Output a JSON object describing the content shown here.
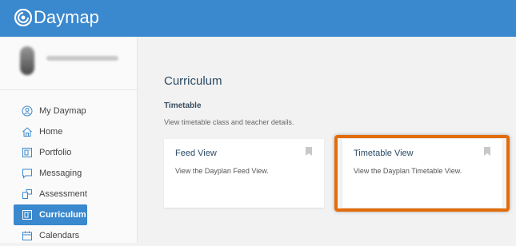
{
  "app": {
    "logo_text": "Daymap"
  },
  "profile": {
    "username": ""
  },
  "sidebar": {
    "items": [
      {
        "label": "My Daymap",
        "icon": "user-circle-icon"
      },
      {
        "label": "Home",
        "icon": "home-icon"
      },
      {
        "label": "Portfolio",
        "icon": "portfolio-icon"
      },
      {
        "label": "Messaging",
        "icon": "message-icon"
      },
      {
        "label": "Assessment",
        "icon": "assessment-icon"
      },
      {
        "label": "Curriculum",
        "icon": "curriculum-icon",
        "active": true
      },
      {
        "label": "Calendars",
        "icon": "calendar-icon"
      }
    ]
  },
  "main": {
    "title": "Curriculum",
    "section_title": "Timetable",
    "section_desc": "View timetable class and teacher details.",
    "cards": [
      {
        "title": "Feed View",
        "desc": "View the Dayplan Feed View."
      },
      {
        "title": "Timetable View",
        "desc": "View the Dayplan Timetable View."
      }
    ]
  },
  "colors": {
    "accent": "#3a88cd",
    "highlight": "#e36c0a"
  }
}
